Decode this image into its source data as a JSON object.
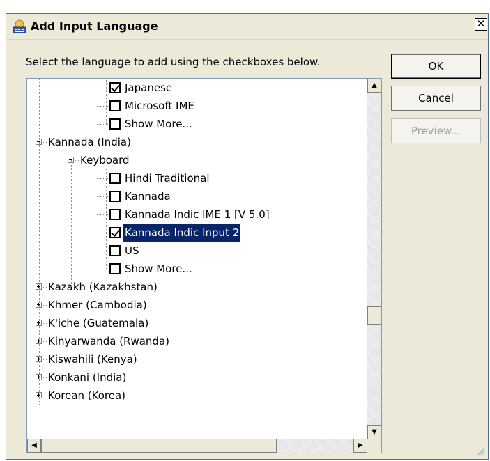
{
  "window": {
    "title": "Add Input Language",
    "close_glyph": "✕"
  },
  "instruction": "Select the language to add using the checkboxes below.",
  "buttons": {
    "ok": "OK",
    "cancel": "Cancel",
    "preview": "Preview..."
  },
  "tree": [
    {
      "label": "Japanese",
      "checkbox": true,
      "checked": true,
      "selected": false
    },
    {
      "label": "Microsoft IME",
      "checkbox": true,
      "checked": false,
      "selected": false
    },
    {
      "label": "Show More...",
      "checkbox": true,
      "checked": false,
      "selected": false
    },
    {
      "label": "Kannada (India)",
      "expander": "minus"
    },
    {
      "label": "Keyboard",
      "expander": "minus"
    },
    {
      "label": "Hindi Traditional",
      "checkbox": true,
      "checked": false,
      "selected": false
    },
    {
      "label": "Kannada",
      "checkbox": true,
      "checked": false,
      "selected": false
    },
    {
      "label": "Kannada Indic IME 1 [V 5.0]",
      "checkbox": true,
      "checked": false,
      "selected": false
    },
    {
      "label": "Kannada Indic Input 2",
      "checkbox": true,
      "checked": true,
      "selected": true
    },
    {
      "label": "US",
      "checkbox": true,
      "checked": false,
      "selected": false
    },
    {
      "label": "Show More...",
      "checkbox": true,
      "checked": false,
      "selected": false
    },
    {
      "label": "Kazakh (Kazakhstan)",
      "expander": "plus"
    },
    {
      "label": "Khmer (Cambodia)",
      "expander": "plus"
    },
    {
      "label": "K'iche (Guatemala)",
      "expander": "plus"
    },
    {
      "label": "Kinyarwanda (Rwanda)",
      "expander": "plus"
    },
    {
      "label": "Kiswahili (Kenya)",
      "expander": "plus"
    },
    {
      "label": "Konkani (India)",
      "expander": "plus"
    },
    {
      "label": "Korean (Korea)",
      "expander": "plus"
    }
  ],
  "scrollbar": {
    "vertical_position": 0.68,
    "horizontal_position": 0.0
  },
  "icons": {
    "title": "keyboard-globe-icon",
    "up": "▲",
    "down": "▼",
    "left": "◀",
    "right": "▶"
  }
}
